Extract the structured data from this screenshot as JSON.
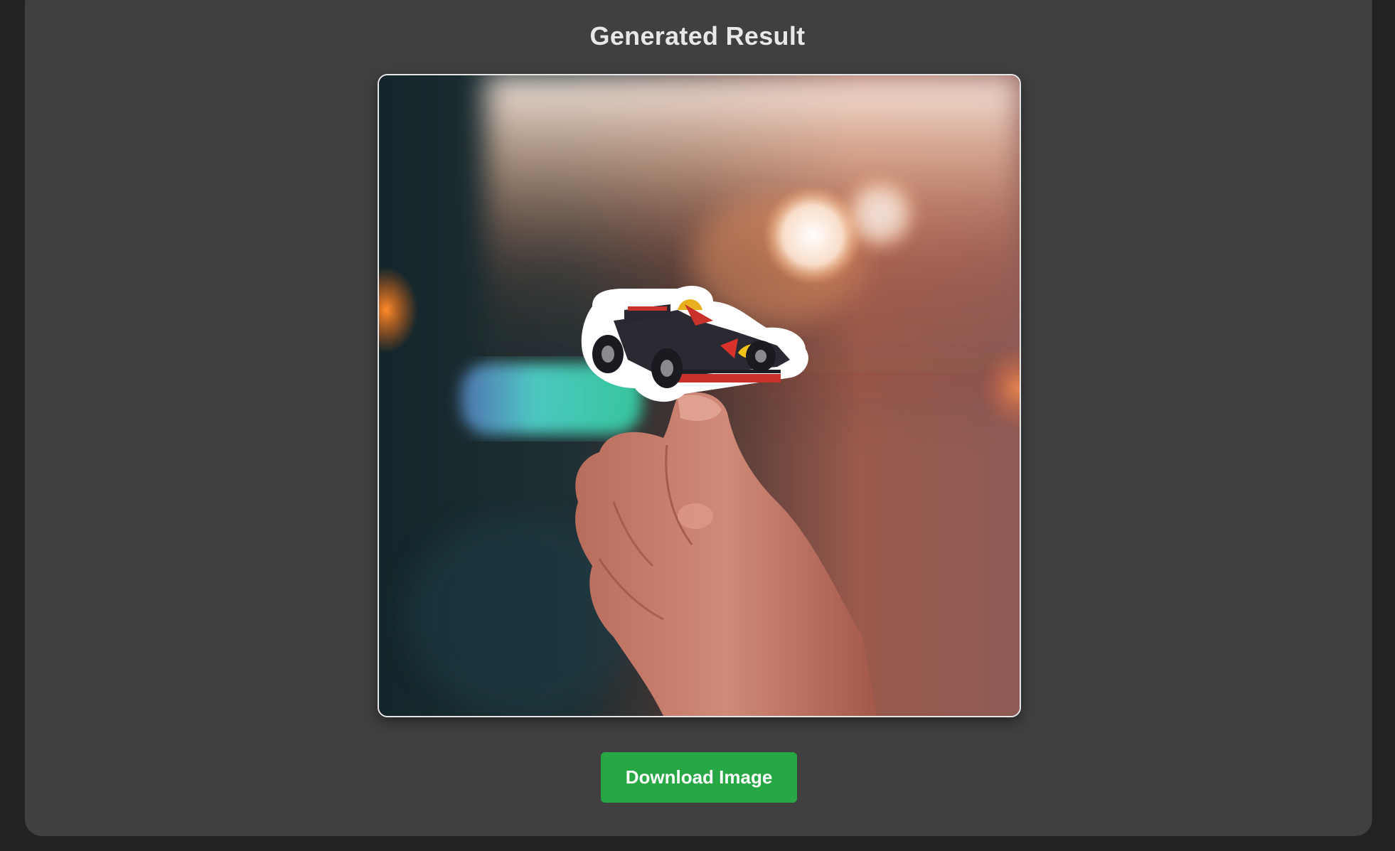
{
  "result": {
    "title": "Generated Result",
    "image_subject": "hand holding race car sticker",
    "download_label": "Download Image"
  },
  "colors": {
    "page_background": "#222222",
    "panel_background": "#404040",
    "button_green": "#28a745",
    "title_text": "#e8e8e8"
  }
}
